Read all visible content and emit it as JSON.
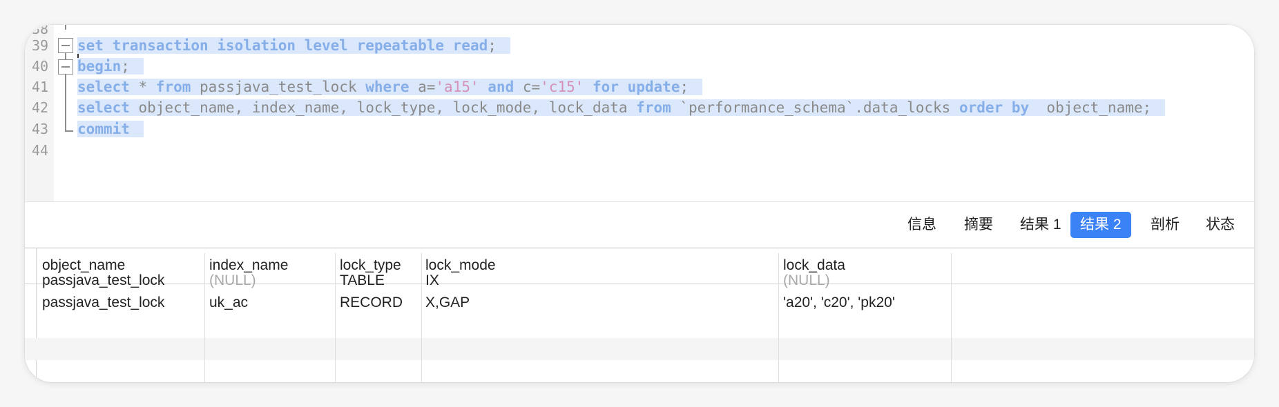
{
  "editor": {
    "line_numbers": [
      "38",
      "39",
      "40",
      "41",
      "42",
      "43",
      "44"
    ],
    "lines": {
      "l39": [
        {
          "t": "set transaction isolation level repeatable read",
          "k": "kw"
        },
        {
          "t": ";",
          "k": ""
        }
      ],
      "l40": [
        {
          "t": "begin",
          "k": "kw"
        },
        {
          "t": ";",
          "k": ""
        }
      ],
      "l41": [
        {
          "t": "select",
          "k": "kw"
        },
        {
          "t": " * ",
          "k": ""
        },
        {
          "t": "from",
          "k": "kw"
        },
        {
          "t": " passjava_test_lock ",
          "k": ""
        },
        {
          "t": "where",
          "k": "kw"
        },
        {
          "t": " a=",
          "k": ""
        },
        {
          "t": "'a15'",
          "k": "str"
        },
        {
          "t": " ",
          "k": ""
        },
        {
          "t": "and",
          "k": "kw"
        },
        {
          "t": " c=",
          "k": ""
        },
        {
          "t": "'c15'",
          "k": "str"
        },
        {
          "t": " ",
          "k": ""
        },
        {
          "t": "for update",
          "k": "kw"
        },
        {
          "t": ";",
          "k": ""
        }
      ],
      "l42": [
        {
          "t": "select",
          "k": "kw"
        },
        {
          "t": " object_name, index_name, lock_type, lock_mode, lock_data ",
          "k": ""
        },
        {
          "t": "from",
          "k": "kw"
        },
        {
          "t": " `performance_schema`.data_locks ",
          "k": ""
        },
        {
          "t": "order by",
          "k": "kw"
        },
        {
          "t": "  object_name;",
          "k": ""
        }
      ],
      "l43": [
        {
          "t": "commit",
          "k": "kw"
        }
      ]
    }
  },
  "tabs": {
    "info": "信息",
    "summary": "摘要",
    "result1": "结果 1",
    "result2": "结果 2",
    "profile": "剖析",
    "status": "状态"
  },
  "grid": {
    "headers": {
      "object_name": "object_name",
      "index_name": "index_name",
      "lock_type": "lock_type",
      "lock_mode": "lock_mode",
      "lock_data": "lock_data"
    },
    "rows": [
      {
        "object_name": "passjava_test_lock",
        "index_name": "(NULL)",
        "lock_type": "TABLE",
        "lock_mode": "IX",
        "lock_data": "(NULL)"
      },
      {
        "object_name": "passjava_test_lock",
        "index_name": "uk_ac",
        "lock_type": "RECORD",
        "lock_mode": "X,GAP",
        "lock_data": "'a20', 'c20', 'pk20'"
      }
    ]
  },
  "colors": {
    "keyword": "#86aee8",
    "string": "#d68fb6",
    "selection": "#dbe8fb",
    "active_tab": "#3b82f6"
  }
}
